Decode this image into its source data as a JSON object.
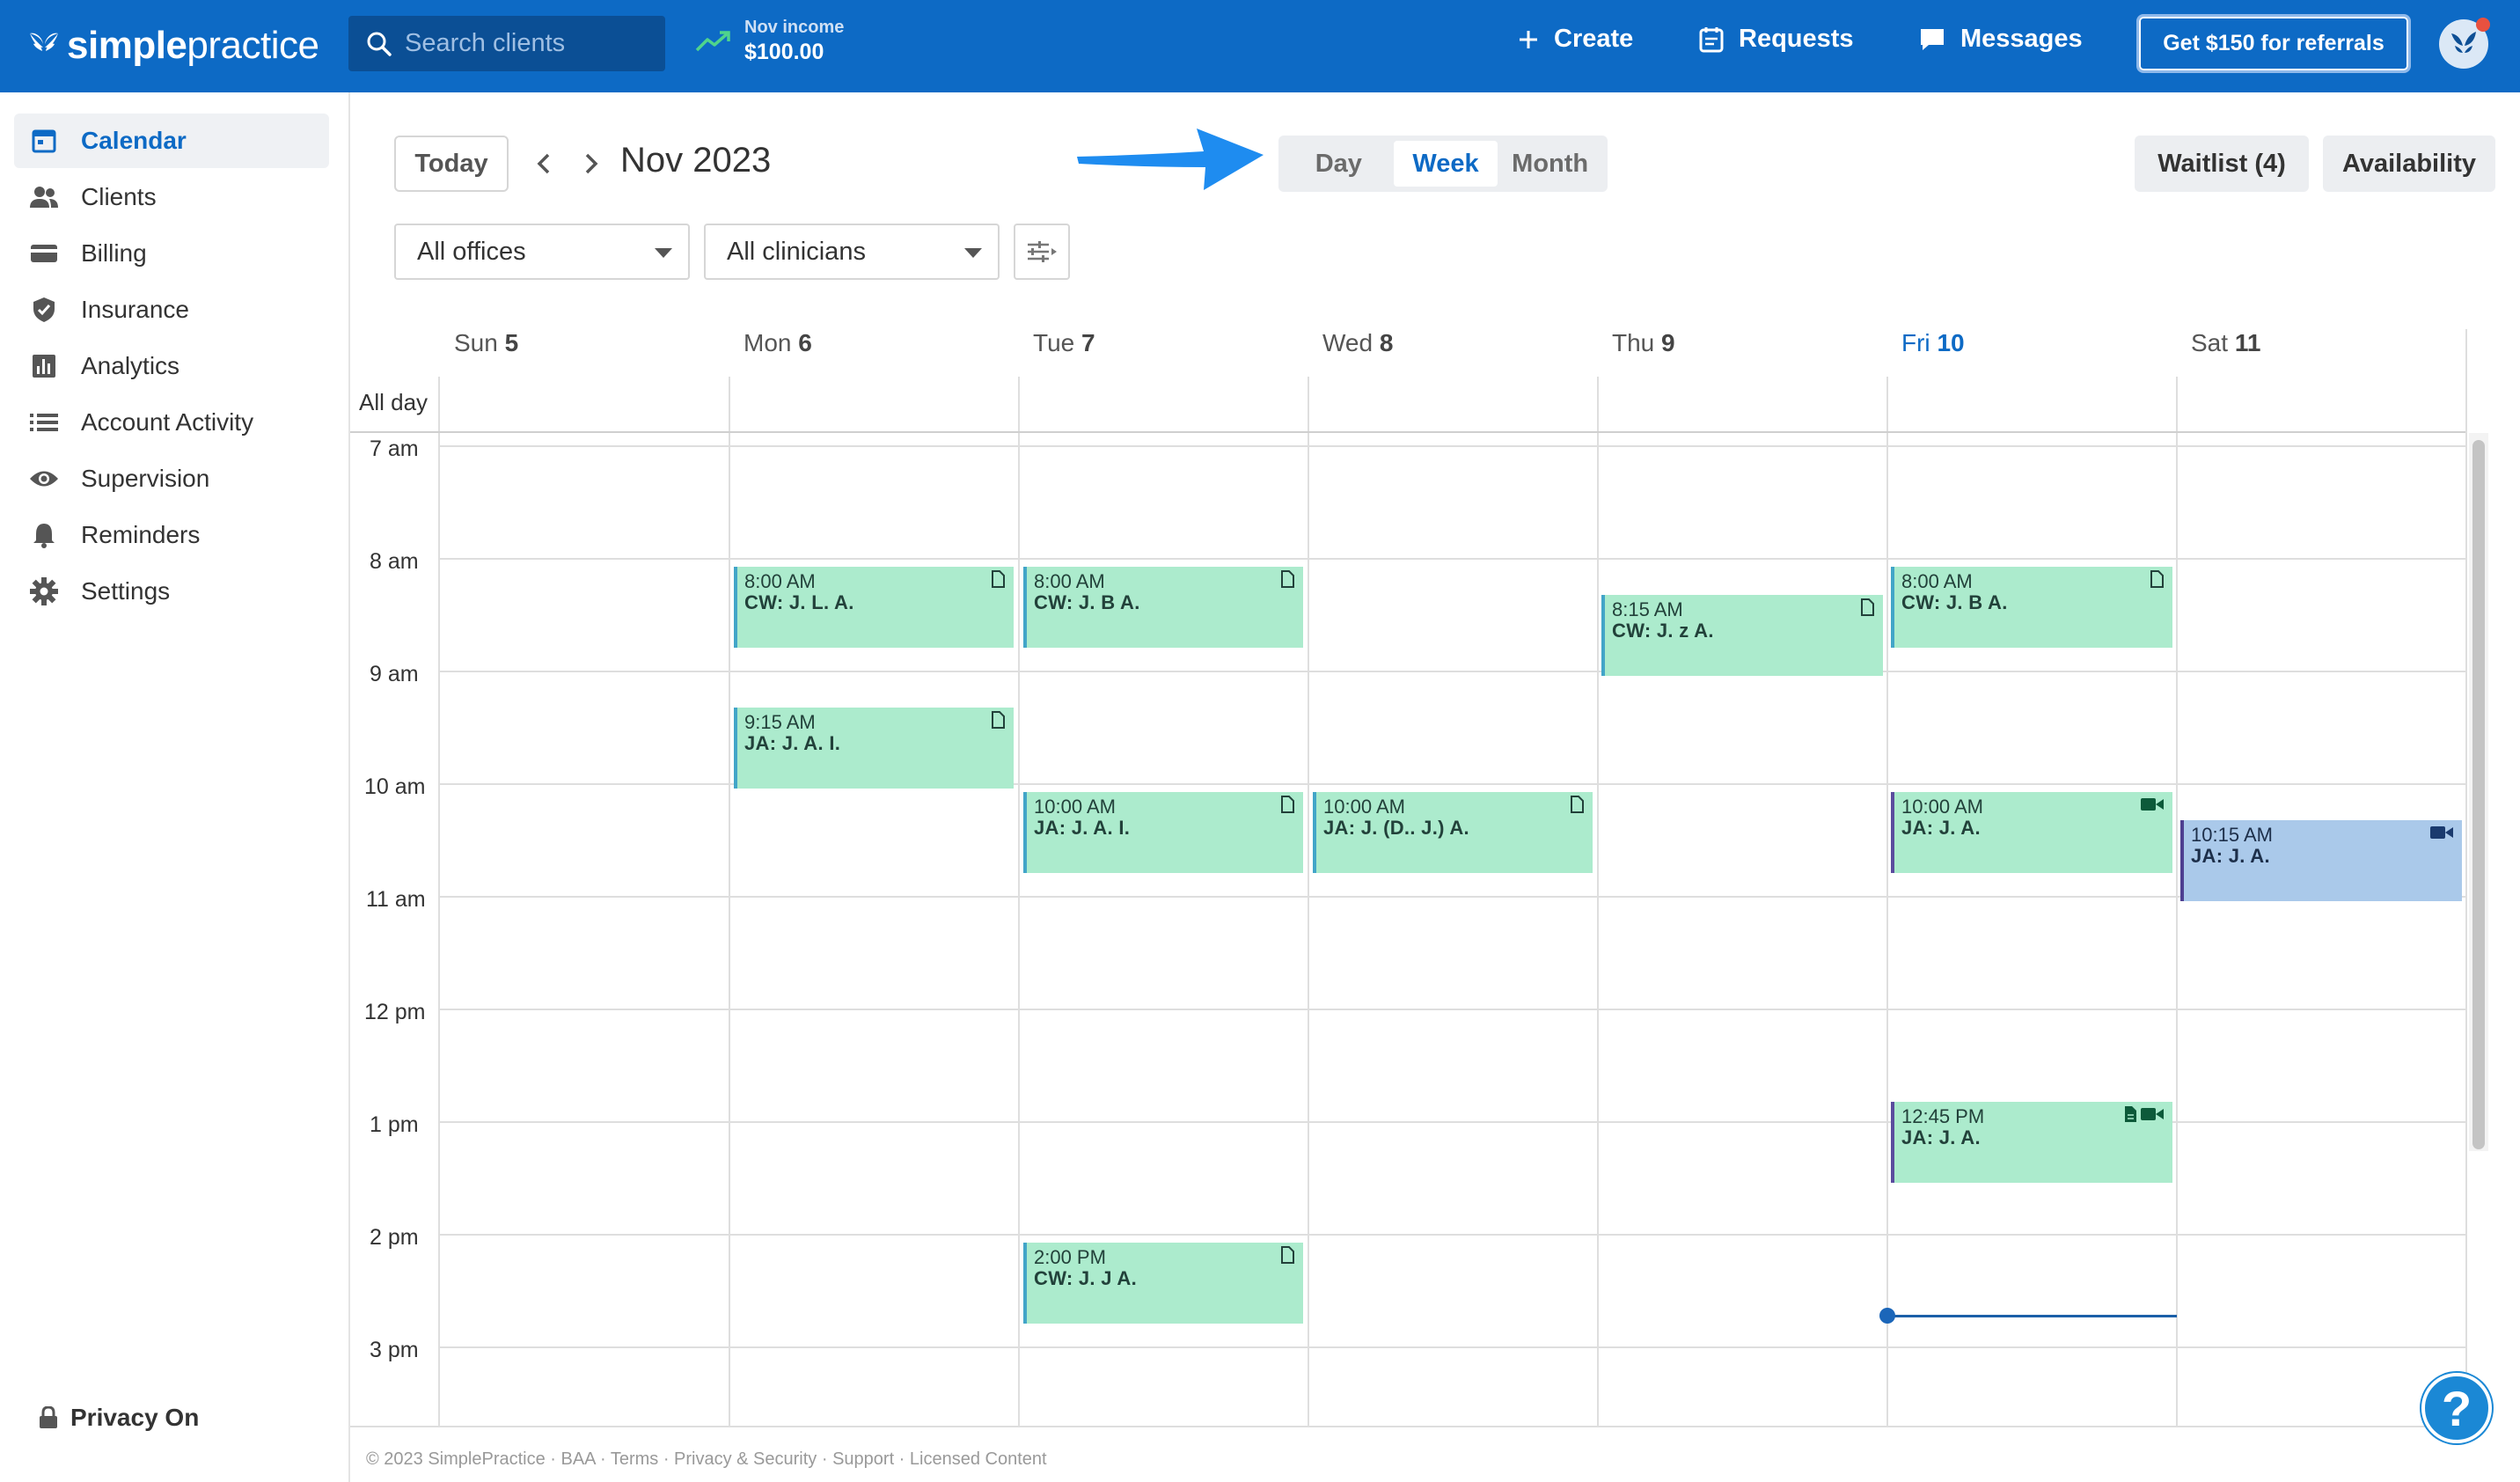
{
  "app": {
    "logo_text_bold": "simple",
    "logo_text_light": "practice"
  },
  "search": {
    "placeholder": "Search clients"
  },
  "income": {
    "label": "Nov income",
    "value": "$100.00"
  },
  "nav": {
    "create": "Create",
    "requests": "Requests",
    "messages": "Messages",
    "referral": "Get $150 for referrals"
  },
  "sidebar": {
    "items": [
      {
        "label": "Calendar",
        "icon": "calendar-icon",
        "active": true
      },
      {
        "label": "Clients",
        "icon": "clients-icon"
      },
      {
        "label": "Billing",
        "icon": "billing-card-icon"
      },
      {
        "label": "Insurance",
        "icon": "shield-icon"
      },
      {
        "label": "Analytics",
        "icon": "bar-chart-icon"
      },
      {
        "label": "Account Activity",
        "icon": "list-icon"
      },
      {
        "label": "Supervision",
        "icon": "eye-icon"
      },
      {
        "label": "Reminders",
        "icon": "bell-icon"
      },
      {
        "label": "Settings",
        "icon": "gear-icon"
      }
    ],
    "privacy": "Privacy On"
  },
  "toolbar": {
    "today": "Today",
    "title": "Nov 2023",
    "views": [
      "Day",
      "Week",
      "Month"
    ],
    "active_view": "Week",
    "waitlist": "Waitlist (4)",
    "availability": "Availability",
    "office_filter": "All offices",
    "clinician_filter": "All clinicians"
  },
  "calendar": {
    "days": [
      {
        "name": "Sun",
        "num": "5"
      },
      {
        "name": "Mon",
        "num": "6"
      },
      {
        "name": "Tue",
        "num": "7"
      },
      {
        "name": "Wed",
        "num": "8"
      },
      {
        "name": "Thu",
        "num": "9"
      },
      {
        "name": "Fri",
        "num": "10",
        "today": true
      },
      {
        "name": "Sat",
        "num": "11"
      }
    ],
    "allday_label": "All day",
    "hours": [
      "7 am",
      "8 am",
      "9 am",
      "10 am",
      "11 am",
      "12 pm",
      "1 pm",
      "2 pm",
      "3 pm"
    ],
    "events": [
      {
        "day": 1,
        "time": "8:00 AM",
        "name": "CW: J. L. A.",
        "icons": [
          "note-icon"
        ],
        "color": "green"
      },
      {
        "day": 2,
        "time": "8:00 AM",
        "name": "CW: J. B A.",
        "icons": [
          "note-icon"
        ],
        "color": "green"
      },
      {
        "day": 4,
        "time": "8:15 AM",
        "name": "CW: J. z A.",
        "icons": [
          "note-icon"
        ],
        "color": "green"
      },
      {
        "day": 5,
        "time": "8:00 AM",
        "name": "CW: J. B A.",
        "icons": [
          "note-icon"
        ],
        "color": "green"
      },
      {
        "day": 1,
        "time": "9:15 AM",
        "name": "JA: J. A. I.",
        "icons": [
          "note-icon"
        ],
        "color": "green"
      },
      {
        "day": 2,
        "time": "10:00 AM",
        "name": "JA: J. A. I.",
        "icons": [
          "note-icon"
        ],
        "color": "green"
      },
      {
        "day": 3,
        "time": "10:00 AM",
        "name": "JA: J. (D.. J.) A.",
        "icons": [
          "note-icon"
        ],
        "color": "green"
      },
      {
        "day": 5,
        "time": "10:00 AM",
        "name": "JA: J. A.",
        "icons": [
          "video-icon"
        ],
        "color": "green-purple"
      },
      {
        "day": 6,
        "time": "10:15 AM",
        "name": "JA: J. A.",
        "icons": [
          "video-icon"
        ],
        "color": "blue"
      },
      {
        "day": 5,
        "time": "12:45 PM",
        "name": "JA: J. A.",
        "icons": [
          "filled-note-icon",
          "video-icon"
        ],
        "color": "green-purple"
      },
      {
        "day": 2,
        "time": "2:00 PM",
        "name": "CW: J. J A.",
        "icons": [
          "note-icon"
        ],
        "color": "green"
      }
    ]
  },
  "footer": "© 2023 SimplePractice · BAA · Terms · Privacy & Security · Support · Licensed Content",
  "help": "?"
}
